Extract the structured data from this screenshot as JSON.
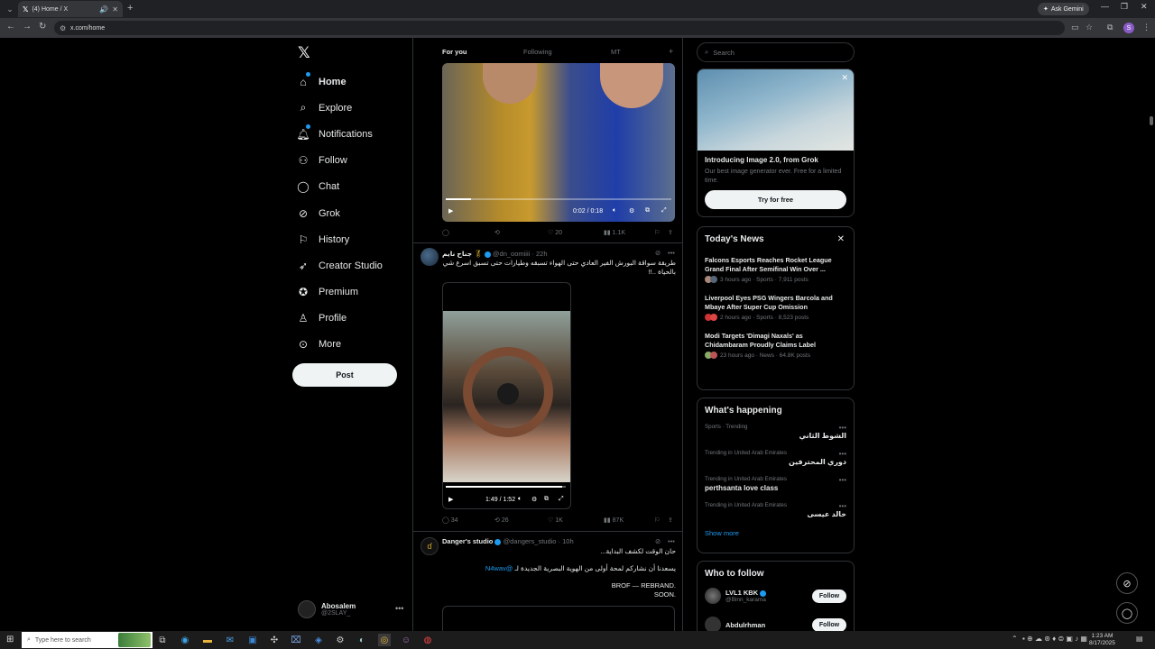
{
  "browser": {
    "tab_title": "(4) Home / X",
    "url": "x.com/home",
    "ask_gemini": "Ask Gemini",
    "profile_initial": "S"
  },
  "nav": {
    "items": [
      {
        "label": "Home",
        "icon": "home-icon"
      },
      {
        "label": "Explore",
        "icon": "search-icon"
      },
      {
        "label": "Notifications",
        "icon": "bell-icon"
      },
      {
        "label": "Follow",
        "icon": "person-plus-icon"
      },
      {
        "label": "Chat",
        "icon": "chat-icon"
      },
      {
        "label": "Grok",
        "icon": "grok-icon"
      },
      {
        "label": "History",
        "icon": "bookmark-icon"
      },
      {
        "label": "Creator Studio",
        "icon": "rocket-icon"
      },
      {
        "label": "Premium",
        "icon": "premium-icon"
      },
      {
        "label": "Profile",
        "icon": "person-icon"
      },
      {
        "label": "More",
        "icon": "more-circle-icon"
      }
    ],
    "post_button": "Post",
    "account": {
      "name": "Abosalem",
      "handle": "@2SLAY_"
    }
  },
  "feed": {
    "tabs": {
      "for_you": "For you",
      "following": "Following",
      "third": "MT"
    },
    "post1": {
      "video_time": "0:02 / 0:18",
      "progress": 0.11,
      "stats": {
        "replies": "",
        "reposts": "",
        "likes": "20",
        "views": "1.1K"
      }
    },
    "post2": {
      "name": "جناح نايم",
      "handle": "@dn_oomiiii",
      "time": "22h",
      "text_line1": "طريقة سواقة البورش الفير العادي حتى الهواء تسبقه وطيارات حتى تسبق اسرع شي",
      "text_line2": "بالحياة ..!!",
      "video_time": "1:49 / 1:52",
      "progress": 0.97,
      "stats": {
        "replies": "34",
        "reposts": "26",
        "likes": "1K",
        "views": "87K"
      }
    },
    "post3": {
      "name": "Danger's studio",
      "handle": "@dangers_studio",
      "time": "10h",
      "text_line1": "حان الوقت لكشف البداية...",
      "text_line2": "يسعدنا أن نشاركم لمحة أولى من الهوية البصرية الجديدة لـ",
      "mention": "@N4wav",
      "text_line3": "BROF — REBRAND.",
      "text_line4": "SOON."
    }
  },
  "right": {
    "search_placeholder": "Search",
    "grok": {
      "title": "Introducing Image 2.0, from Grok",
      "subtitle": "Our best image generator ever. Free for a limited time.",
      "button": "Try for free"
    },
    "news": {
      "heading": "Today's News",
      "items": [
        {
          "title": "Falcons Esports Reaches Rocket League Grand Final After Semifinal Win Over ...",
          "meta": "3 hours ago · Sports · 7,911 posts"
        },
        {
          "title": "Liverpool Eyes PSG Wingers Barcola and Mbaye After Super Cup Omission",
          "meta": "2 hours ago · Sports · 8,523 posts"
        },
        {
          "title": "Modi Targets 'Dimagi Naxals' as Chidambaram Proudly Claims Label",
          "meta": "23 hours ago · News · 64.8K posts"
        }
      ]
    },
    "happening": {
      "heading": "What's happening",
      "trends": [
        {
          "category": "Sports · Trending",
          "name": "الشوط الثاني",
          "rtl": true
        },
        {
          "category": "Trending in United Arab Emirates",
          "name": "دوري المحترفين",
          "rtl": true
        },
        {
          "category": "Trending in United Arab Emirates",
          "name": "perthsanta love class",
          "rtl": false
        },
        {
          "category": "Trending in United Arab Emirates",
          "name": "خالد عيسى",
          "rtl": true
        }
      ],
      "show_more": "Show more"
    },
    "who_to_follow": {
      "heading": "Who to follow",
      "people": [
        {
          "name": "LVL1 KBK",
          "handle": "@Binn_karama",
          "button": "Follow"
        },
        {
          "name": "Abdulrhman",
          "handle": "",
          "button": "Follow"
        }
      ]
    }
  },
  "taskbar": {
    "search_placeholder": "Type here to search",
    "time": "1:23 AM",
    "date": "8/17/2025"
  }
}
